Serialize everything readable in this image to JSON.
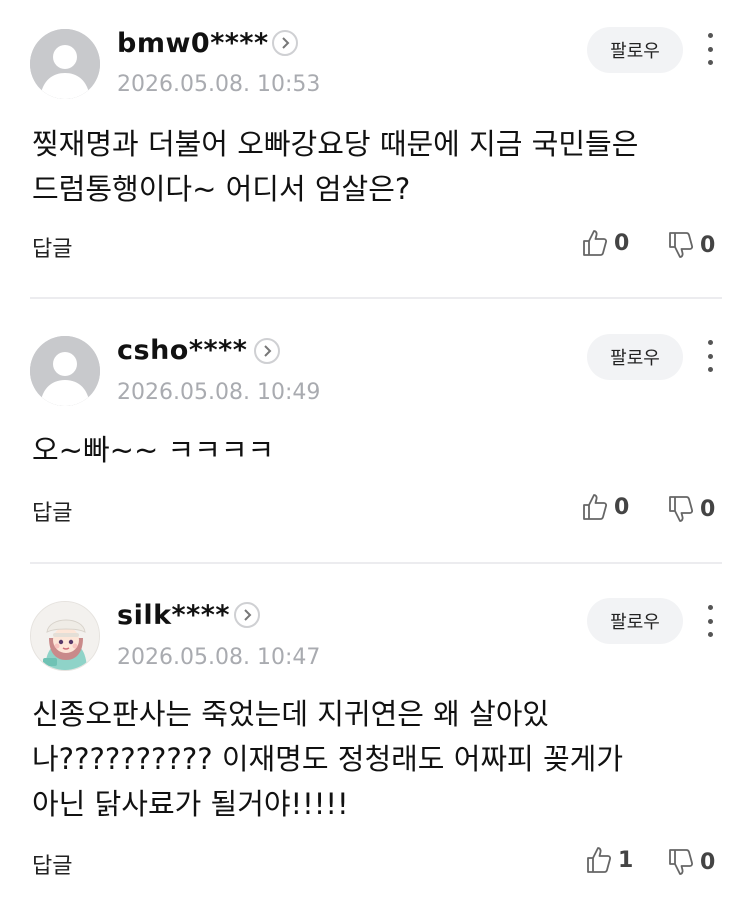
{
  "comments": [
    {
      "username": "bmw0****",
      "timestamp": "2026.05.08. 10:53",
      "follow_label": "팔로우",
      "text": "찢재명과 더불어 오빠강요당 때문에 지금 국민들은\n드럼통행이다~ 어디서 엄살은?",
      "reply_label": "답글",
      "likes": "0",
      "dislikes": "0",
      "avatar": "default-avatar"
    },
    {
      "username": "csho****",
      "timestamp": "2026.05.08. 10:49",
      "follow_label": "팔로우",
      "text": "오~빠~~ ㅋㅋㅋㅋ",
      "reply_label": "답글",
      "likes": "0",
      "dislikes": "0",
      "avatar": "default-avatar"
    },
    {
      "username": "silk****",
      "timestamp": "2026.05.08. 10:47",
      "follow_label": "팔로우",
      "text": "신종오판사는 죽었는데 지귀연은 왜 살아있\n나?????????? 이재명도 정청래도 어짜피 꽂게가\n아닌 닭사료가 될거야!!!!!",
      "reply_label": "답글",
      "likes": "1",
      "dislikes": "0",
      "avatar": "character-avatar"
    }
  ],
  "icons": {
    "chevron": "chevron-right-icon",
    "more": "more-vertical-icon",
    "like": "thumbs-up-icon",
    "dislike": "thumbs-down-icon"
  },
  "colors": {
    "divider": "#ececef",
    "date": "#a9abb0",
    "follow_bg": "#f2f3f5"
  }
}
